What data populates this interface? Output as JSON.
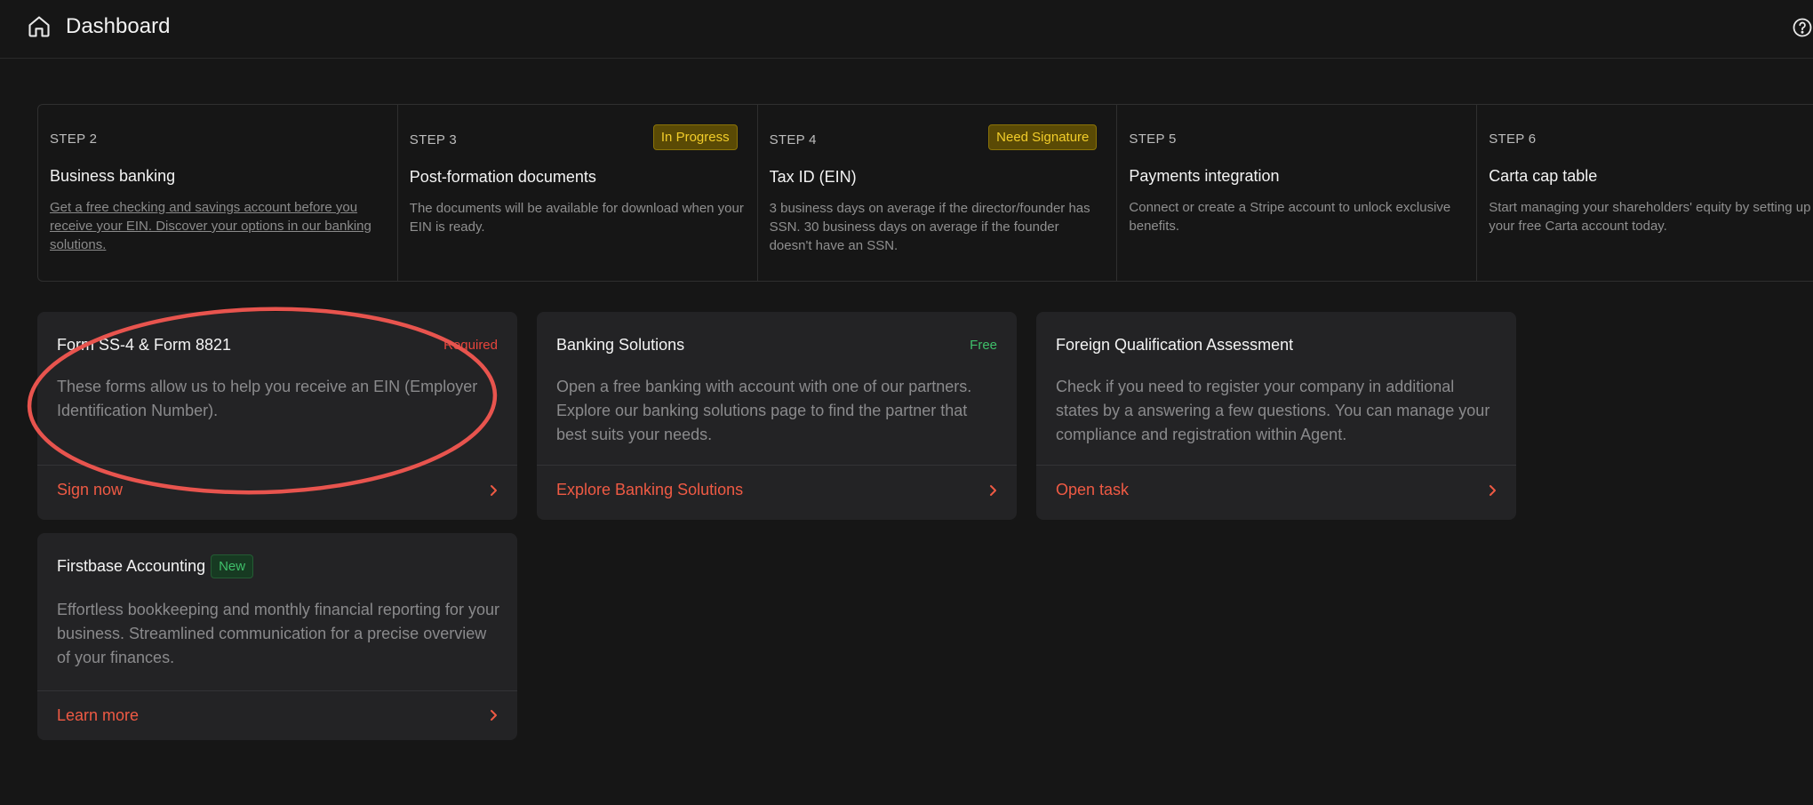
{
  "header": {
    "title": "Dashboard",
    "home_icon": "home-icon",
    "help_icon": "help-icon"
  },
  "steps": [
    {
      "num": "STEP 2",
      "title": "Business banking",
      "desc": "Get a free checking and savings account before you receive your EIN. Discover your options in our banking solutions.",
      "badge": ""
    },
    {
      "num": "STEP 3",
      "title": "Post-formation documents",
      "desc": "The documents will be available for download when your EIN is ready.",
      "badge": "In Progress"
    },
    {
      "num": "STEP 4",
      "title": "Tax ID (EIN)",
      "desc": "3 business days on average if the director/founder has SSN. 30 business days on average if the founder doesn't have an SSN.",
      "badge": "Need Signature"
    },
    {
      "num": "STEP 5",
      "title": "Payments integration",
      "desc": "Connect or create a Stripe account to unlock exclusive benefits.",
      "badge": ""
    },
    {
      "num": "STEP 6",
      "title": "Carta cap table",
      "desc": "Start managing your shareholders' equity by setting up your free Carta account today.",
      "badge": ""
    }
  ],
  "cards": {
    "form": {
      "title": "Form SS-4 & Form 8821",
      "tag": "Required",
      "desc": "These forms allow us to help you receive an EIN (Employer Identification Number).",
      "action": "Sign now"
    },
    "banking": {
      "title": "Banking Solutions",
      "tag": "Free",
      "desc": "Open a free banking with account with one of our partners. Explore our banking solutions page to find the partner that best suits your needs.",
      "action": "Explore Banking Solutions"
    },
    "foreign": {
      "title": "Foreign Qualification Assessment",
      "desc": "Check if you need to register your company in additional states by a answering a few questions. You can manage your compliance and registration within Agent.",
      "action": "Open task"
    },
    "accounting": {
      "title": "Firstbase Accounting",
      "badge": "New",
      "desc": "Effortless bookkeeping and monthly financial reporting for your business. Streamlined communication for a precise overview of your finances.",
      "action": "Learn more"
    }
  },
  "colors": {
    "background": "#161616",
    "card": "#232325",
    "accent_red": "#ef5a44",
    "annotation": "#e8544e",
    "warning_badge": "#f2cd2a",
    "success": "#3fbf6a"
  }
}
